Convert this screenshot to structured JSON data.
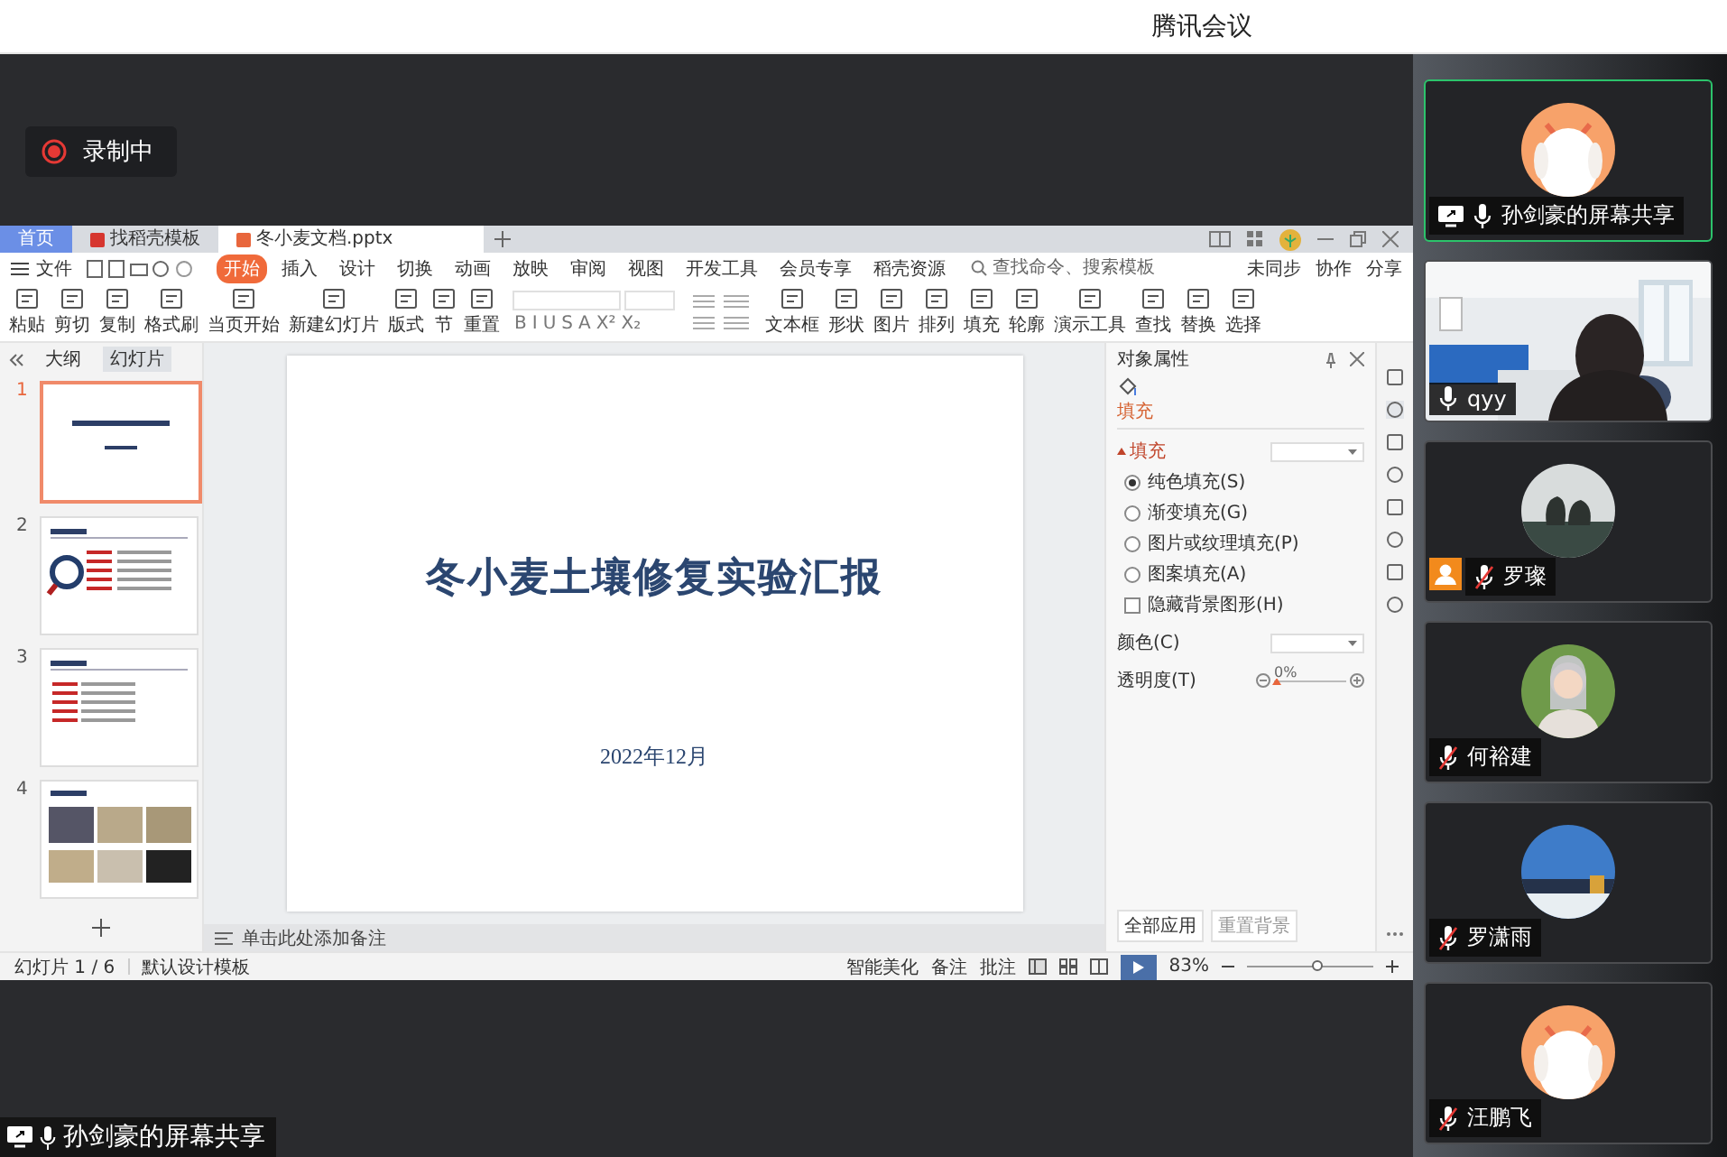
{
  "app_title": "腾讯会议",
  "recording": {
    "label": "录制中",
    "on": true
  },
  "wps": {
    "tabs": [
      {
        "label": "首页",
        "kind": "home",
        "selected": false
      },
      {
        "label": "找稻壳模板",
        "kind": "docer",
        "selected": false
      },
      {
        "label": "冬小麦文档.pptx",
        "kind": "file",
        "selected": true
      }
    ],
    "file_menu": "文件",
    "ribbon_tabs": [
      {
        "label": "开始",
        "selected": true
      },
      {
        "label": "插入",
        "selected": false
      },
      {
        "label": "设计",
        "selected": false
      },
      {
        "label": "切换",
        "selected": false
      },
      {
        "label": "动画",
        "selected": false
      },
      {
        "label": "放映",
        "selected": false
      },
      {
        "label": "审阅",
        "selected": false
      },
      {
        "label": "视图",
        "selected": false
      },
      {
        "label": "开发工具",
        "selected": false
      },
      {
        "label": "会员专享",
        "selected": false
      },
      {
        "label": "稻壳资源",
        "selected": false
      }
    ],
    "search": {
      "placeholder": "查找命令、搜索模板"
    },
    "actions": [
      "未同步",
      "协作",
      "分享"
    ],
    "tools_left": [
      "粘贴",
      "剪切",
      "复制",
      "格式刷",
      "当页开始",
      "新建幻灯片",
      "版式",
      "节",
      "重置"
    ],
    "format_buttons": [
      "B",
      "I",
      "U",
      "S",
      "A",
      "X²",
      "X₂"
    ],
    "tools_right": [
      "文本框",
      "形状",
      "图片",
      "排列",
      "填充",
      "轮廓",
      "演示工具",
      "查找",
      "替换",
      "选择"
    ],
    "outline_tabs": [
      {
        "label": "大纲",
        "selected": false
      },
      {
        "label": "幻灯片",
        "selected": true
      }
    ],
    "slides": [
      {
        "number": "1",
        "selected": true
      },
      {
        "number": "2",
        "selected": false
      },
      {
        "number": "3",
        "selected": false
      },
      {
        "number": "4",
        "selected": false
      }
    ],
    "slide": {
      "title": "冬小麦土壤修复实验汇报",
      "date": "2022年12月"
    },
    "notes_placeholder": "单击此处添加备注",
    "panel": {
      "title": "对象属性",
      "tab": "填充",
      "section": "填充",
      "options": [
        {
          "label": "纯色填充(S)",
          "kind": "radio",
          "checked": true
        },
        {
          "label": "渐变填充(G)",
          "kind": "radio",
          "checked": false
        },
        {
          "label": "图片或纹理填充(P)",
          "kind": "radio",
          "checked": false
        },
        {
          "label": "图案填充(A)",
          "kind": "radio",
          "checked": false
        },
        {
          "label": "隐藏背景图形(H)",
          "kind": "checkbox",
          "checked": false
        }
      ],
      "color_label": "颜色(C)",
      "transparency_label": "透明度(T)",
      "transparency": {
        "reading": "0%",
        "level": 0
      },
      "buttons": [
        "全部应用",
        "重置背景"
      ]
    },
    "status": {
      "slide_count": "幻灯片 1 / 6",
      "template": "默认设计模板",
      "beautify": "智能美化",
      "notes": "备注",
      "comments": "批注",
      "zoom": "83%",
      "zoom_slider": {
        "level": 0.55
      }
    }
  },
  "share_label": "孙剑豪的屏幕共享",
  "participants": [
    {
      "name": "孙剑豪的屏幕共享",
      "kind": "avatar",
      "speaking": true,
      "muted": false,
      "sharing": true,
      "profile_badge": false
    },
    {
      "name": "qyy",
      "kind": "video",
      "speaking": false,
      "muted": false,
      "sharing": false,
      "profile_badge": false
    },
    {
      "name": "罗璨",
      "kind": "avatar",
      "speaking": false,
      "muted": true,
      "sharing": false,
      "profile_badge": true
    },
    {
      "name": "何裕建",
      "kind": "avatar",
      "speaking": false,
      "muted": true,
      "sharing": false,
      "profile_badge": false
    },
    {
      "name": "罗潇雨",
      "kind": "avatar",
      "speaking": false,
      "muted": true,
      "sharing": false,
      "profile_badge": false
    },
    {
      "name": "汪鹏飞",
      "kind": "avatar",
      "speaking": false,
      "muted": true,
      "sharing": false,
      "profile_badge": false
    }
  ]
}
